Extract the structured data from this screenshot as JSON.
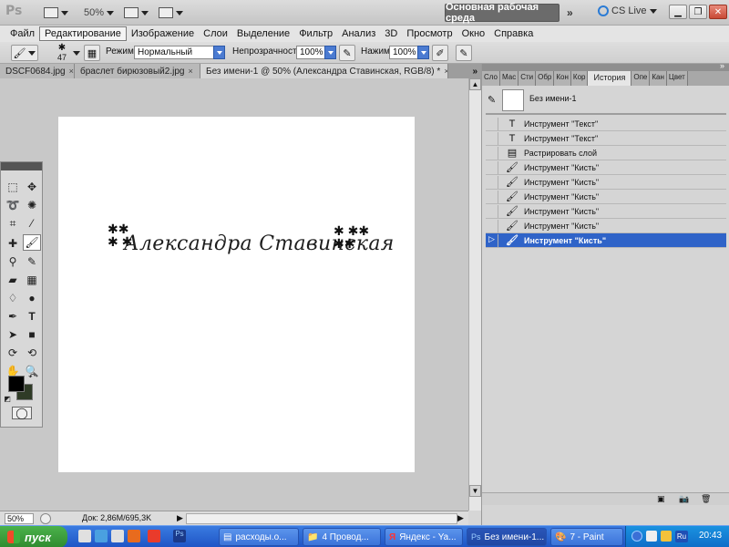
{
  "app": {
    "logo": "Ps",
    "zoom": "50%",
    "workspace_button": "Основная рабочая среда",
    "cslive": "CS Live",
    "more": "»"
  },
  "menu": [
    "Файл",
    "Редактирование",
    "Изображение",
    "Слои",
    "Выделение",
    "Фильтр",
    "Анализ",
    "3D",
    "Просмотр",
    "Окно",
    "Справка"
  ],
  "options": {
    "brush_size": "47",
    "mode_label": "Режим:",
    "mode_value": "Нормальный",
    "opacity_label": "Непрозрачность:",
    "opacity_value": "100%",
    "pressure_label": "Нажим:",
    "pressure_value": "100%"
  },
  "doc_tabs": [
    {
      "label": "DSCF0684.jpg"
    },
    {
      "label": "браслет бирюзовый2.jpg"
    },
    {
      "label": "Без имени-1 @ 50% (Александра Ставинская, RGB/8) *"
    }
  ],
  "canvas": {
    "signature": "Александра Ставинская"
  },
  "status": {
    "zoom": "50%",
    "doc_info": "Док: 2,86M/695,3K"
  },
  "panel": {
    "tabs": [
      "Сло",
      "Мас",
      "Сти",
      "Обр",
      "Кон",
      "Кор",
      "История",
      "Опе",
      "Кан",
      "Цвет"
    ],
    "active_tab": "История",
    "snapshot_label": "Без имени-1",
    "history": [
      {
        "icon": "text-tool-icon",
        "label": "Инструмент \"Текст\""
      },
      {
        "icon": "text-tool-icon",
        "label": "Инструмент \"Текст\""
      },
      {
        "icon": "rasterize-layer-icon",
        "label": "Растрировать слой"
      },
      {
        "icon": "brush-tool-icon",
        "label": "Инструмент \"Кисть\""
      },
      {
        "icon": "brush-tool-icon",
        "label": "Инструмент \"Кисть\""
      },
      {
        "icon": "brush-tool-icon",
        "label": "Инструмент \"Кисть\""
      },
      {
        "icon": "brush-tool-icon",
        "label": "Инструмент \"Кисть\""
      },
      {
        "icon": "brush-tool-icon",
        "label": "Инструмент \"Кисть\""
      },
      {
        "icon": "brush-tool-icon",
        "label": "Инструмент \"Кисть\"",
        "selected": true
      }
    ]
  },
  "taskbar": {
    "start": "пуск",
    "tasks": [
      {
        "label": "расходы.о..."
      },
      {
        "label": "4 Провод..."
      },
      {
        "label": "Яндекс - Ya..."
      },
      {
        "label": "Без имени-1..."
      },
      {
        "label": "7 - Paint"
      }
    ],
    "lang": "Ru",
    "time": "20:43"
  },
  "colors": {
    "selection": "#2f63c8",
    "foreground": "#000000",
    "background": "#2f3b26",
    "taskbar": "#245edb",
    "start": "#3c9c3c"
  }
}
